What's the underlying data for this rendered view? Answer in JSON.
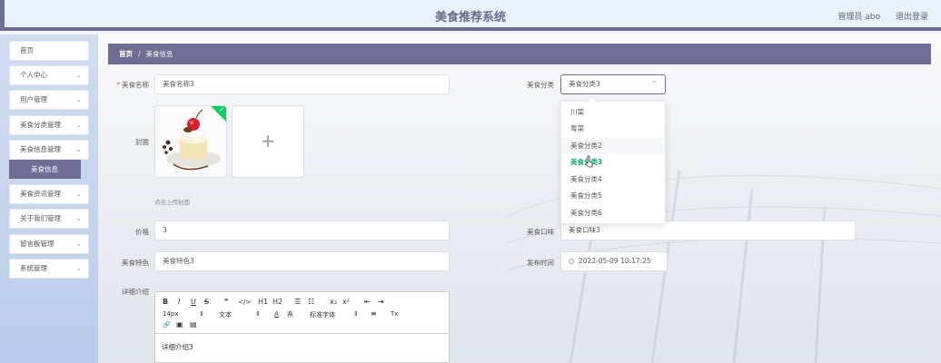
{
  "header": {
    "site_title": "美食推荐系统",
    "user_label": "管理员 abo",
    "logout_label": "退出登录"
  },
  "sidebar": {
    "items": [
      {
        "label": "首页",
        "has_chevron": false
      },
      {
        "label": "个人中心",
        "has_chevron": true
      },
      {
        "label": "用户管理",
        "has_chevron": true
      },
      {
        "label": "美食分类管理",
        "has_chevron": true
      },
      {
        "label": "美食信息管理",
        "has_chevron": true
      },
      {
        "label": "美食资讯管理",
        "has_chevron": true
      },
      {
        "label": "关于我们管理",
        "has_chevron": true
      },
      {
        "label": "留言板管理",
        "has_chevron": true
      },
      {
        "label": "系统管理",
        "has_chevron": true
      }
    ],
    "active_submenu": "美食信息",
    "chevron": "⌄"
  },
  "breadcrumb": {
    "home": "首页",
    "separator": "/",
    "current": "美食信息"
  },
  "form": {
    "name_label": "美食名称",
    "name_value": "美食名称3",
    "category_label": "美食分类",
    "category_value": "美食分类3",
    "cover_label": "封面",
    "upload_hint": "点击上传封面",
    "upload_plus": "+",
    "price_label": "价格",
    "price_value": "3",
    "taste_label": "美食口味",
    "taste_value": "美食口味3",
    "feature_label": "美食特色",
    "feature_value": "美食特色3",
    "publish_label": "发布时间",
    "publish_value": "2022-05-09 10:17:25",
    "detail_label": "详细介绍",
    "detail_value": "详细介绍3",
    "required_mark": "*"
  },
  "dropdown": {
    "options": [
      "川菜",
      "粤菜",
      "美食分类2",
      "美食分类3",
      "美食分类4",
      "美食分类5",
      "美食分类6"
    ],
    "selected": "美食分类3",
    "hovered": "美食分类2"
  },
  "editor_toolbar": {
    "bold": "B",
    "italic": "I",
    "underline": "U",
    "strike": "S",
    "quote": "❞",
    "code": "</>",
    "h1": "H1",
    "h2": "H2",
    "ol": "☰",
    "ul": "☷",
    "sub": "x₂",
    "sup": "x²",
    "indent_less": "⇤",
    "indent_more": "⇥",
    "font_size": "14px",
    "text_style": "文本",
    "font_color": "A",
    "bg_color": "A",
    "font_family": "标准字体",
    "align": "≡",
    "clear": "Tx",
    "link": "🔗",
    "image": "▣",
    "video": "▤",
    "spin": "⇕"
  },
  "colors": {
    "theme": "#6e6d92",
    "success": "#13ce66",
    "selected_text": "#13a86a"
  }
}
